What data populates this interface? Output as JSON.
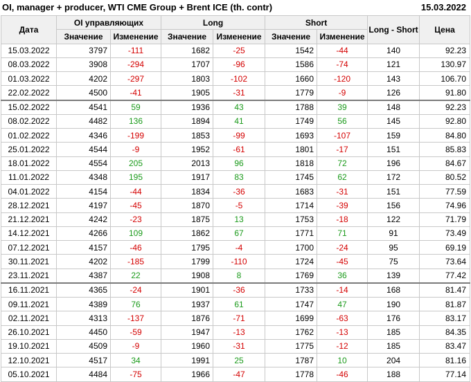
{
  "header": {
    "title": "OI, manager + producer, WTI CME Group + Brent ICE (th. contr)",
    "date": "15.03.2022"
  },
  "columns": {
    "date": "Дата",
    "oi_group": "OI управляющих",
    "long_group": "Long",
    "short_group": "Short",
    "value": "Значение",
    "change": "Изменение",
    "long_short": "Long - Short",
    "price": "Цена"
  },
  "colors": {
    "negative": "#d40000",
    "positive": "#1a9a1a",
    "header_bg": "#f0f0f0"
  },
  "rows": [
    {
      "date": "15.03.2022",
      "oi": "3797",
      "oi_chg": "-111",
      "long": "1682",
      "long_chg": "-25",
      "short": "1542",
      "short_chg": "-44",
      "ls": "140",
      "price": "92.23"
    },
    {
      "date": "08.03.2022",
      "oi": "3908",
      "oi_chg": "-294",
      "long": "1707",
      "long_chg": "-96",
      "short": "1586",
      "short_chg": "-74",
      "ls": "121",
      "price": "130.97"
    },
    {
      "date": "01.03.2022",
      "oi": "4202",
      "oi_chg": "-297",
      "long": "1803",
      "long_chg": "-102",
      "short": "1660",
      "short_chg": "-120",
      "ls": "143",
      "price": "106.70"
    },
    {
      "date": "22.02.2022",
      "oi": "4500",
      "oi_chg": "-41",
      "long": "1905",
      "long_chg": "-31",
      "short": "1779",
      "short_chg": "-9",
      "ls": "126",
      "price": "91.80"
    },
    {
      "date": "15.02.2022",
      "oi": "4541",
      "oi_chg": "59",
      "long": "1936",
      "long_chg": "43",
      "short": "1788",
      "short_chg": "39",
      "ls": "148",
      "price": "92.23"
    },
    {
      "date": "08.02.2022",
      "oi": "4482",
      "oi_chg": "136",
      "long": "1894",
      "long_chg": "41",
      "short": "1749",
      "short_chg": "56",
      "ls": "145",
      "price": "92.80"
    },
    {
      "date": "01.02.2022",
      "oi": "4346",
      "oi_chg": "-199",
      "long": "1853",
      "long_chg": "-99",
      "short": "1693",
      "short_chg": "-107",
      "ls": "159",
      "price": "84.80"
    },
    {
      "date": "25.01.2022",
      "oi": "4544",
      "oi_chg": "-9",
      "long": "1952",
      "long_chg": "-61",
      "short": "1801",
      "short_chg": "-17",
      "ls": "151",
      "price": "85.83"
    },
    {
      "date": "18.01.2022",
      "oi": "4554",
      "oi_chg": "205",
      "long": "2013",
      "long_chg": "96",
      "short": "1818",
      "short_chg": "72",
      "ls": "196",
      "price": "84.67"
    },
    {
      "date": "11.01.2022",
      "oi": "4348",
      "oi_chg": "195",
      "long": "1917",
      "long_chg": "83",
      "short": "1745",
      "short_chg": "62",
      "ls": "172",
      "price": "80.52"
    },
    {
      "date": "04.01.2022",
      "oi": "4154",
      "oi_chg": "-44",
      "long": "1834",
      "long_chg": "-36",
      "short": "1683",
      "short_chg": "-31",
      "ls": "151",
      "price": "77.59"
    },
    {
      "date": "28.12.2021",
      "oi": "4197",
      "oi_chg": "-45",
      "long": "1870",
      "long_chg": "-5",
      "short": "1714",
      "short_chg": "-39",
      "ls": "156",
      "price": "74.96"
    },
    {
      "date": "21.12.2021",
      "oi": "4242",
      "oi_chg": "-23",
      "long": "1875",
      "long_chg": "13",
      "short": "1753",
      "short_chg": "-18",
      "ls": "122",
      "price": "71.79"
    },
    {
      "date": "14.12.2021",
      "oi": "4266",
      "oi_chg": "109",
      "long": "1862",
      "long_chg": "67",
      "short": "1771",
      "short_chg": "71",
      "ls": "91",
      "price": "73.49"
    },
    {
      "date": "07.12.2021",
      "oi": "4157",
      "oi_chg": "-46",
      "long": "1795",
      "long_chg": "-4",
      "short": "1700",
      "short_chg": "-24",
      "ls": "95",
      "price": "69.19"
    },
    {
      "date": "30.11.2021",
      "oi": "4202",
      "oi_chg": "-185",
      "long": "1799",
      "long_chg": "-110",
      "short": "1724",
      "short_chg": "-45",
      "ls": "75",
      "price": "73.64"
    },
    {
      "date": "23.11.2021",
      "oi": "4387",
      "oi_chg": "22",
      "long": "1908",
      "long_chg": "8",
      "short": "1769",
      "short_chg": "36",
      "ls": "139",
      "price": "77.42"
    },
    {
      "date": "16.11.2021",
      "oi": "4365",
      "oi_chg": "-24",
      "long": "1901",
      "long_chg": "-36",
      "short": "1733",
      "short_chg": "-14",
      "ls": "168",
      "price": "81.47"
    },
    {
      "date": "09.11.2021",
      "oi": "4389",
      "oi_chg": "76",
      "long": "1937",
      "long_chg": "61",
      "short": "1747",
      "short_chg": "47",
      "ls": "190",
      "price": "81.87"
    },
    {
      "date": "02.11.2021",
      "oi": "4313",
      "oi_chg": "-137",
      "long": "1876",
      "long_chg": "-71",
      "short": "1699",
      "short_chg": "-63",
      "ls": "176",
      "price": "83.17"
    },
    {
      "date": "26.10.2021",
      "oi": "4450",
      "oi_chg": "-59",
      "long": "1947",
      "long_chg": "-13",
      "short": "1762",
      "short_chg": "-13",
      "ls": "185",
      "price": "84.35"
    },
    {
      "date": "19.10.2021",
      "oi": "4509",
      "oi_chg": "-9",
      "long": "1960",
      "long_chg": "-31",
      "short": "1775",
      "short_chg": "-12",
      "ls": "185",
      "price": "83.47"
    },
    {
      "date": "12.10.2021",
      "oi": "4517",
      "oi_chg": "34",
      "long": "1991",
      "long_chg": "25",
      "short": "1787",
      "short_chg": "10",
      "ls": "204",
      "price": "81.16"
    },
    {
      "date": "05.10.2021",
      "oi": "4484",
      "oi_chg": "-75",
      "long": "1966",
      "long_chg": "-47",
      "short": "1778",
      "short_chg": "-46",
      "ls": "188",
      "price": "77.14"
    }
  ]
}
